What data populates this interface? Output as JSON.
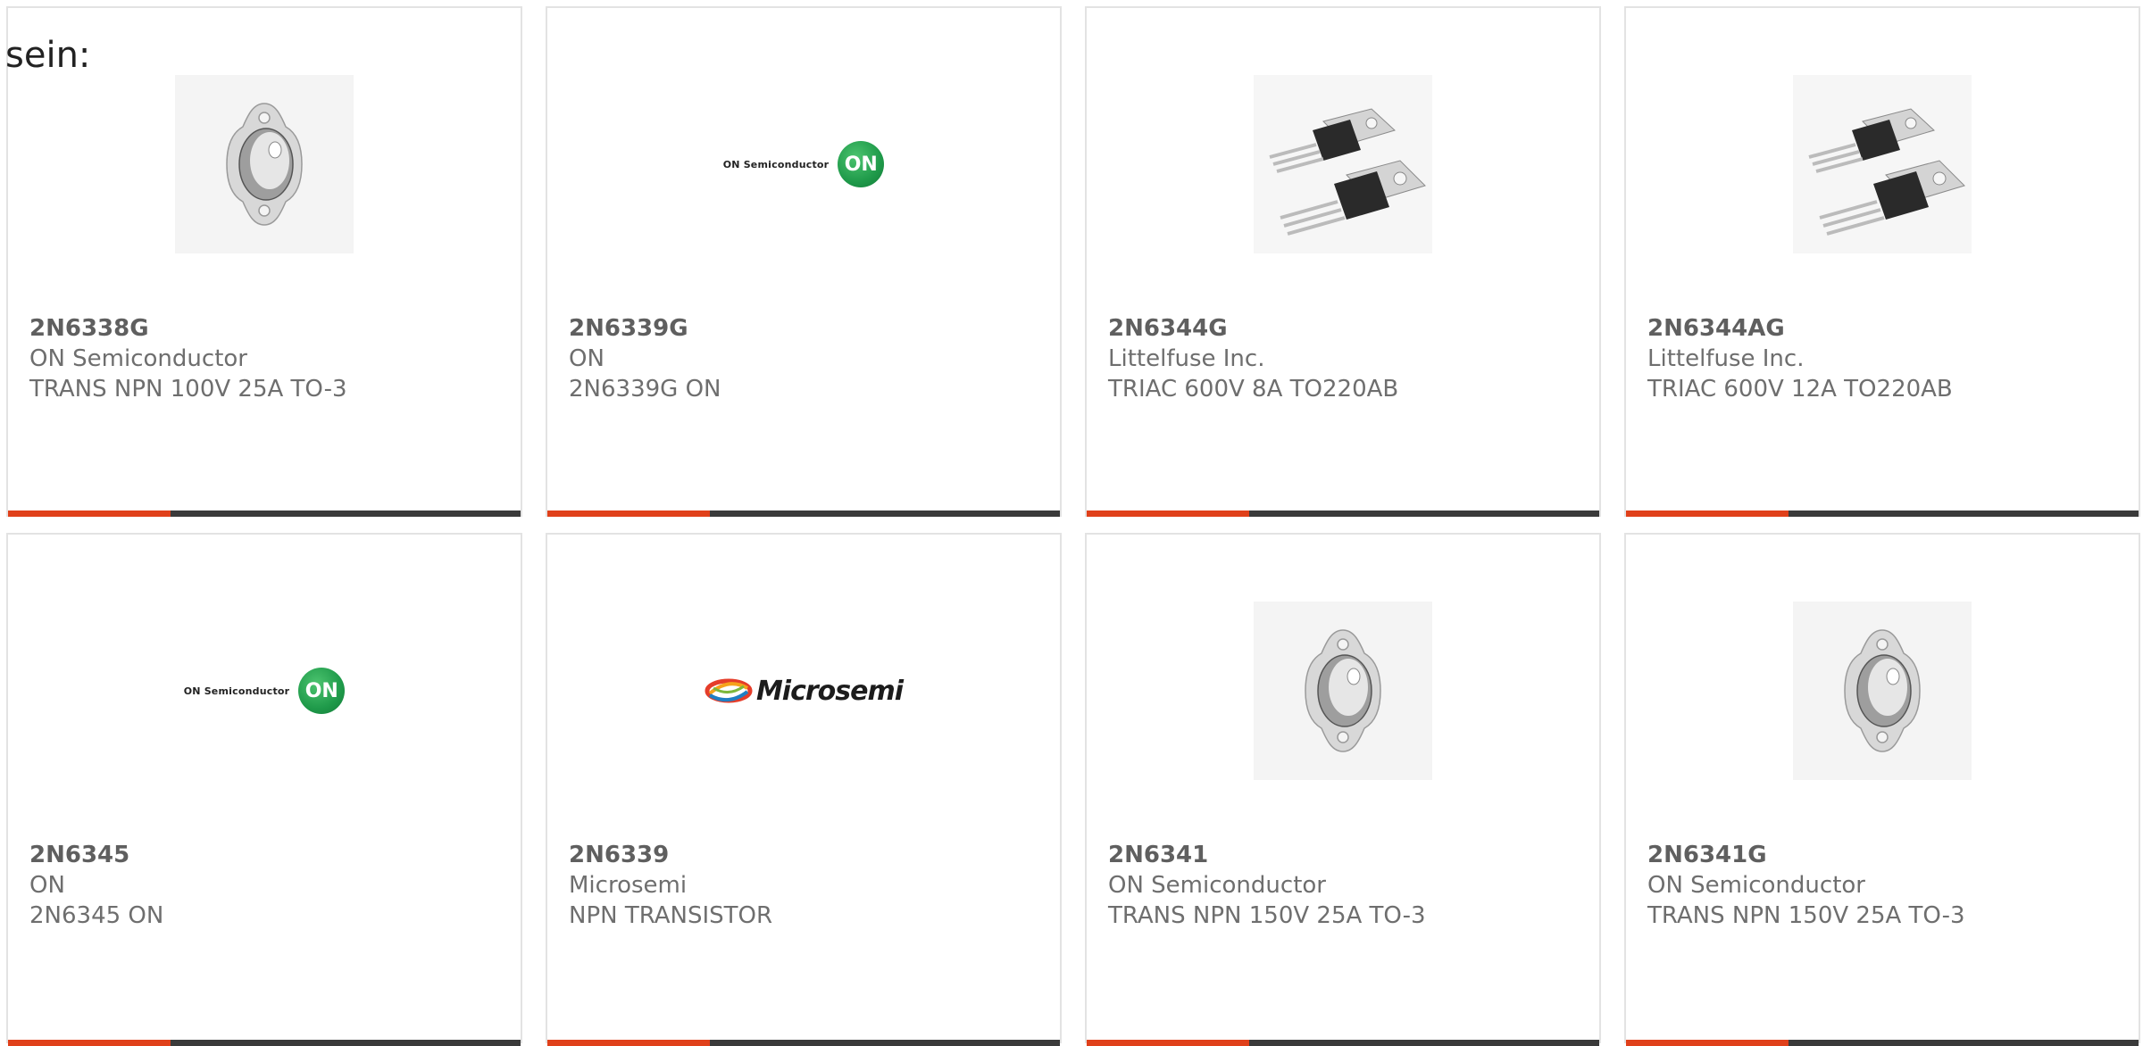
{
  "page_prefix": "sein:",
  "colors": {
    "accent": "#e0401a",
    "bar_dark": "#3a3a3a",
    "card_border": "#e3e3e3",
    "text": "#6e6e6e",
    "on_green": "#1f9a4a"
  },
  "products": [
    {
      "part": "2N6338G",
      "manufacturer": "ON Semiconductor",
      "description": "TRANS NPN 100V 25A TO-3",
      "image": "to3-transistor-icon"
    },
    {
      "part": "2N6339G",
      "manufacturer": "ON",
      "description": "2N6339G ON",
      "image": "on-semiconductor-logo",
      "logo_text": "ON Semiconductor",
      "logo_mark": "ON"
    },
    {
      "part": "2N6344G",
      "manufacturer": "Littelfuse Inc.",
      "description": "TRIAC 600V 8A TO220AB",
      "image": "to220-package-icon"
    },
    {
      "part": "2N6344AG",
      "manufacturer": "Littelfuse Inc.",
      "description": "TRIAC 600V 12A TO220AB",
      "image": "to220-package-icon"
    },
    {
      "part": "2N6345",
      "manufacturer": "ON",
      "description": "2N6345 ON",
      "image": "on-semiconductor-logo",
      "logo_text": "ON Semiconductor",
      "logo_mark": "ON"
    },
    {
      "part": "2N6339",
      "manufacturer": "Microsemi",
      "description": "NPN TRANSISTOR",
      "image": "microsemi-logo",
      "logo_text": "Microsemi"
    },
    {
      "part": "2N6341",
      "manufacturer": "ON Semiconductor",
      "description": "TRANS NPN 150V 25A TO-3",
      "image": "to3-transistor-icon"
    },
    {
      "part": "2N6341G",
      "manufacturer": "ON Semiconductor",
      "description": "TRANS NPN 150V 25A TO-3",
      "image": "to3-transistor-icon"
    }
  ]
}
